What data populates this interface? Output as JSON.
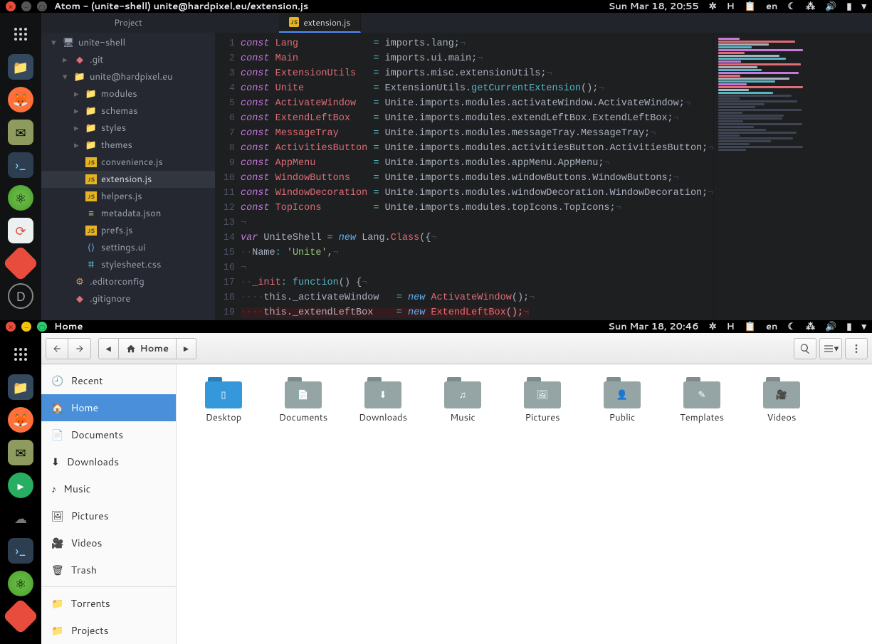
{
  "atom": {
    "title": "Atom - (unite-shell) unite@hardpixel.eu/extension.js",
    "datetime": "Sun Mar 18, 20:55",
    "locale": "en",
    "project_label": "Project",
    "tree": {
      "root": "unite-shell",
      "git": ".git",
      "pkg": "unite@hardpixel.eu",
      "folders": [
        "modules",
        "schemas",
        "styles",
        "themes"
      ],
      "files": [
        "convenience.js",
        "extension.js",
        "helpers.js",
        "metadata.json",
        "prefs.js",
        "settings.ui",
        "stylesheet.css"
      ],
      "editorconfig": ".editorconfig",
      "gitignore": ".gitignore"
    },
    "tab": "extension.js",
    "code": [
      {
        "n": 1,
        "t": "const",
        "id": "Lang",
        "rhs": "imports.lang;"
      },
      {
        "n": 2,
        "t": "const",
        "id": "Main",
        "rhs": "imports.ui.main;"
      },
      {
        "n": 3,
        "t": "const",
        "id": "ExtensionUtils",
        "rhs": "imports.misc.extensionUtils;"
      },
      {
        "n": 4,
        "t": "const",
        "id": "Unite",
        "rhs_pre": "ExtensionUtils.",
        "rhs_func": "getCurrentExtension",
        "rhs_post": "();"
      },
      {
        "n": 5,
        "t": "const",
        "id": "ActivateWindow",
        "rhs": "Unite.imports.modules.activateWindow.ActivateWindow;"
      },
      {
        "n": 6,
        "t": "const",
        "id": "ExtendLeftBox",
        "rhs": "Unite.imports.modules.extendLeftBox.ExtendLeftBox;"
      },
      {
        "n": 7,
        "t": "const",
        "id": "MessageTray",
        "rhs": "Unite.imports.modules.messageTray.MessageTray;"
      },
      {
        "n": 8,
        "t": "const",
        "id": "ActivitiesButton",
        "rhs": "Unite.imports.modules.activitiesButton.ActivitiesButton;"
      },
      {
        "n": 9,
        "t": "const",
        "id": "AppMenu",
        "rhs": "Unite.imports.modules.appMenu.AppMenu;"
      },
      {
        "n": 10,
        "t": "const",
        "id": "WindowButtons",
        "rhs": "Unite.imports.modules.windowButtons.WindowButtons;"
      },
      {
        "n": 11,
        "t": "const",
        "id": "WindowDecoration",
        "rhs": "Unite.imports.modules.windowDecoration.WindowDecoration;"
      },
      {
        "n": 12,
        "t": "const",
        "id": "TopIcons",
        "rhs": "Unite.imports.modules.topIcons.TopIcons;"
      },
      {
        "n": 13,
        "blank": true
      },
      {
        "n": 14,
        "varline": true,
        "v": "var",
        "id": "UniteShell",
        "rhs_pre": "",
        "rhs_new": "new",
        "rhs_ctor": "Lang.Class",
        "rhs_tail": "({"
      },
      {
        "n": 15,
        "name_line": true,
        "key": "Name",
        "val": "'Unite'"
      },
      {
        "n": 16,
        "blank": true
      },
      {
        "n": 17,
        "init_line": true,
        "key": "_init",
        "val": "function"
      },
      {
        "n": 18,
        "assign_line": true,
        "lhs": "this._activateWindow",
        "ctor": "ActivateWindow"
      },
      {
        "n": 19,
        "assign_line": true,
        "lhs": "this._extendLeftBox",
        "ctor": "ExtendLeftBox",
        "err": true
      }
    ]
  },
  "files": {
    "title": "Home",
    "datetime": "Sun Mar 18, 20:46",
    "locale": "en",
    "path": "Home",
    "sidebar": [
      "Recent",
      "Home",
      "Documents",
      "Downloads",
      "Music",
      "Pictures",
      "Videos",
      "Trash",
      "Torrents",
      "Projects"
    ],
    "grid": [
      "Desktop",
      "Documents",
      "Downloads",
      "Music",
      "Pictures",
      "Public",
      "Templates",
      "Videos"
    ]
  }
}
